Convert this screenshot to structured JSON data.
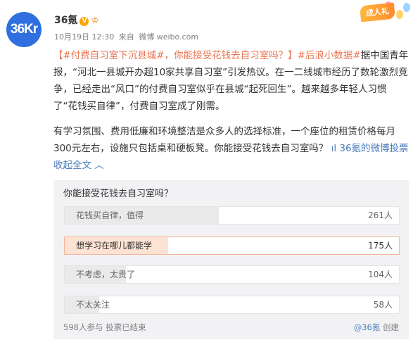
{
  "post": {
    "author": "36氪",
    "date": "10月19日 12:30",
    "source_prefix": "来自",
    "source": "微博 weibo.com",
    "paragraph1": {
      "open_bracket": "【",
      "tag1": "#付费自习室下沉县城#",
      "question": "，你能接受花钱去自习室吗？】",
      "tag2": "#后浪小数据#",
      "body": "据中国青年报，“河北一县城开办超10家共享自习室”引发热议。在一二线城市经历了数轮激烈竞争，已经走出“风口”的付费自习室似乎在县城“起死回生”。越来越多年轻人习惯了“花钱买自律”，付费自习室成了刚需。"
    },
    "paragraph2": {
      "body": "有学习氛围、费用低廉和环境整洁是众多人的选择标准，一个座位的租赁价格每月300元左右，设施只包括桌和硬板凳。你能接受花钱去自习室吗？",
      "author_link": "36氪的",
      "poll_link": "微博投票",
      "collapse": "收起全文"
    },
    "badge": "成人礼"
  },
  "poll": {
    "title": "你能接受花钱去自习室吗？",
    "options": [
      {
        "label": "花钱买自律，值得",
        "count": "261人",
        "votes": 261
      },
      {
        "label": "想学习在哪儿都能学",
        "count": "175人",
        "votes": 175
      },
      {
        "label": "不考虑，太贵了",
        "count": "104人",
        "votes": 104
      },
      {
        "label": "不太关注",
        "count": "58人",
        "votes": 58
      }
    ],
    "participants": "598人参与",
    "status": "投票已结束",
    "creator": "@36氪",
    "created": "创建"
  },
  "colors": {
    "accent": "#eb7350",
    "link_blue": "#4a7cbd",
    "avatar": "#2f6fe0"
  }
}
